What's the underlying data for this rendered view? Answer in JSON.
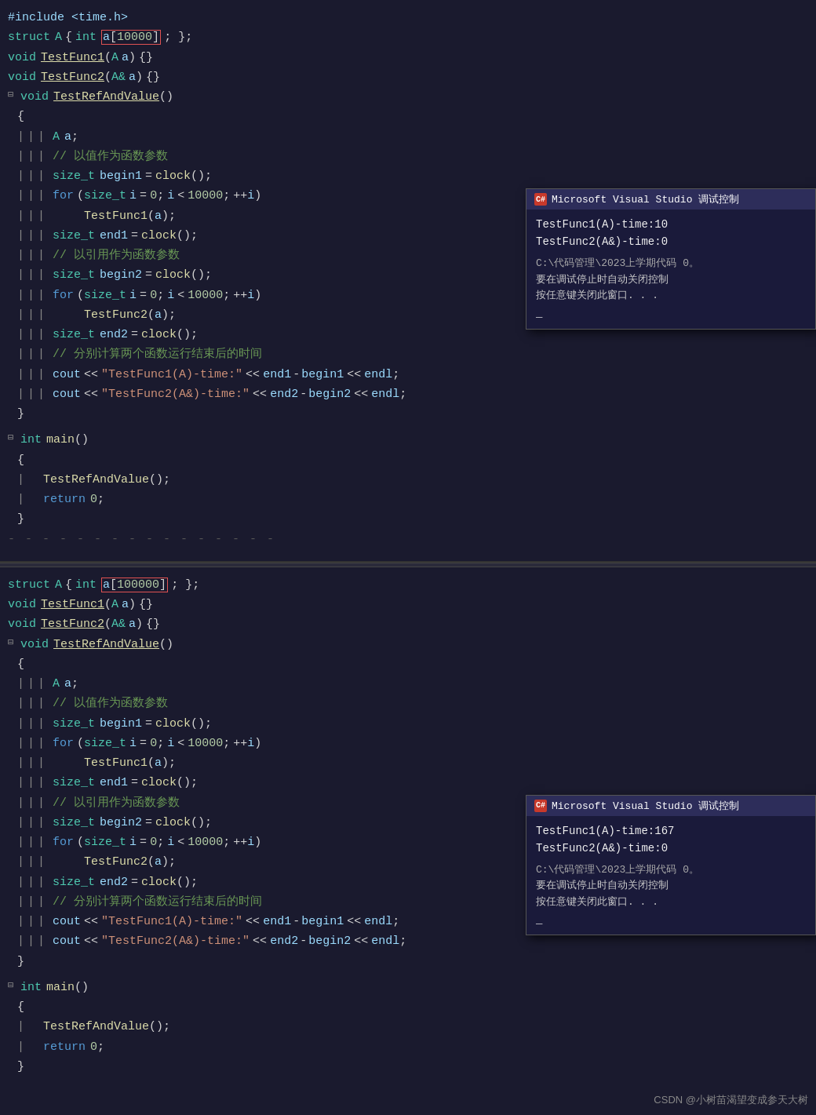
{
  "panel1": {
    "lines": [
      {
        "type": "include",
        "text": "#include <time.h>"
      },
      {
        "type": "struct",
        "text": "struct A { int a[10000]; };",
        "highlight": "a[10000]"
      },
      {
        "type": "code",
        "text": "void TestFunc1(A a)  {}"
      },
      {
        "type": "code",
        "text": "void TestFunc2(A& a)  {}"
      },
      {
        "type": "fold",
        "text": "void TestRefAndValue()"
      },
      {
        "type": "code",
        "text": "{"
      },
      {
        "type": "code",
        "text": "    A a;"
      },
      {
        "type": "comment",
        "text": "    // 以值作为函数参数"
      },
      {
        "type": "code",
        "text": "    size_t begin1 = clock();"
      },
      {
        "type": "code",
        "text": "    for (size_t i = 0; i < 10000; ++i)"
      },
      {
        "type": "code",
        "text": "        TestFunc1(a);"
      },
      {
        "type": "code",
        "text": "    size_t end1 = clock();"
      },
      {
        "type": "comment",
        "text": "    // 以引用作为函数参数"
      },
      {
        "type": "code",
        "text": "    size_t begin2 = clock();"
      },
      {
        "type": "code",
        "text": "    for (size_t i = 0; i < 10000; ++i)"
      },
      {
        "type": "code",
        "text": "        TestFunc2(a);"
      },
      {
        "type": "code",
        "text": "    size_t end2 = clock();"
      },
      {
        "type": "comment",
        "text": "    // 分别计算两个函数运行结束后的时间"
      },
      {
        "type": "code",
        "text": "    cout << \"TestFunc1(A)-time:\" << end1 - begin1 << endl;"
      },
      {
        "type": "code",
        "text": "    cout << \"TestFunc2(A&)-time:\" << end2 - begin2 << endl;"
      },
      {
        "type": "code",
        "text": "}"
      }
    ],
    "popup": {
      "title": "Microsoft Visual Studio 调试控制",
      "output1": "TestFunc1(A)-time:10",
      "output2": "TestFunc2(A&)-time:0",
      "path": "C:\\代码管理\\2023上学期代码",
      "path2": " 0。",
      "notice1": "要在调试停止时自动关闭控制",
      "notice2": "按任意键关闭此窗口. . .",
      "cursor": "_"
    },
    "fold_lines": [
      {
        "text": "⊟int main()"
      },
      {
        "text": "{"
      },
      {
        "text": "    TestRefAndValue();"
      },
      {
        "text": "    return 0;"
      },
      {
        "text": "}"
      },
      {
        "text": "- - - - - - - - -"
      }
    ]
  },
  "panel2": {
    "lines": [
      {
        "type": "struct",
        "text": "struct A { int a[100000]; };",
        "highlight": "a[100000]"
      },
      {
        "type": "code",
        "text": "void TestFunc1(A a)  {}"
      },
      {
        "type": "code",
        "text": "void TestFunc2(A& a)  {}"
      },
      {
        "type": "fold",
        "text": "void TestRefAndValue()"
      },
      {
        "type": "code",
        "text": "{"
      },
      {
        "type": "code",
        "text": "    A a;"
      },
      {
        "type": "comment",
        "text": "    // 以值作为函数参数"
      },
      {
        "type": "code",
        "text": "    size_t begin1 = clock();"
      },
      {
        "type": "code",
        "text": "    for (size_t i = 0; i < 10000; ++i)"
      },
      {
        "type": "code",
        "text": "        TestFunc1(a);"
      },
      {
        "type": "code",
        "text": "    size_t end1 = clock();"
      },
      {
        "type": "comment",
        "text": "    // 以引用作为函数参数"
      },
      {
        "type": "code",
        "text": "    size_t begin2 = clock();"
      },
      {
        "type": "code",
        "text": "    for (size_t i = 0; i < 10000; ++i)"
      },
      {
        "type": "code",
        "text": "        TestFunc2(a);"
      },
      {
        "type": "code",
        "text": "    size_t end2 = clock();"
      },
      {
        "type": "comment",
        "text": "    // 分别计算两个函数运行结束后的时间"
      },
      {
        "type": "code",
        "text": "    cout << \"TestFunc1(A)-time:\" << end1 - begin1 << endl;"
      },
      {
        "type": "code",
        "text": "    cout << \"TestFunc2(A&)-time:\" << end2 - begin2 << endl;"
      },
      {
        "type": "code",
        "text": "}"
      }
    ],
    "popup": {
      "title": "Microsoft Visual Studio 调试控制",
      "output1": "TestFunc1(A)-time:167",
      "output2": "TestFunc2(A&)-time:0",
      "path": "C:\\代码管理\\2023上学期代码",
      "path2": " 0。",
      "notice1": "要在调试停止时自动关闭控制",
      "notice2": "按任意键关闭此窗口. . .",
      "cursor": "_"
    },
    "fold_lines": [
      {
        "text": "⊟int main()"
      },
      {
        "text": "{"
      },
      {
        "text": "    TestRefAndValue();"
      },
      {
        "text": "    return 0;"
      },
      {
        "text": "}"
      }
    ]
  },
  "watermark": "CSDN @小树苗渴望变成参天大树"
}
